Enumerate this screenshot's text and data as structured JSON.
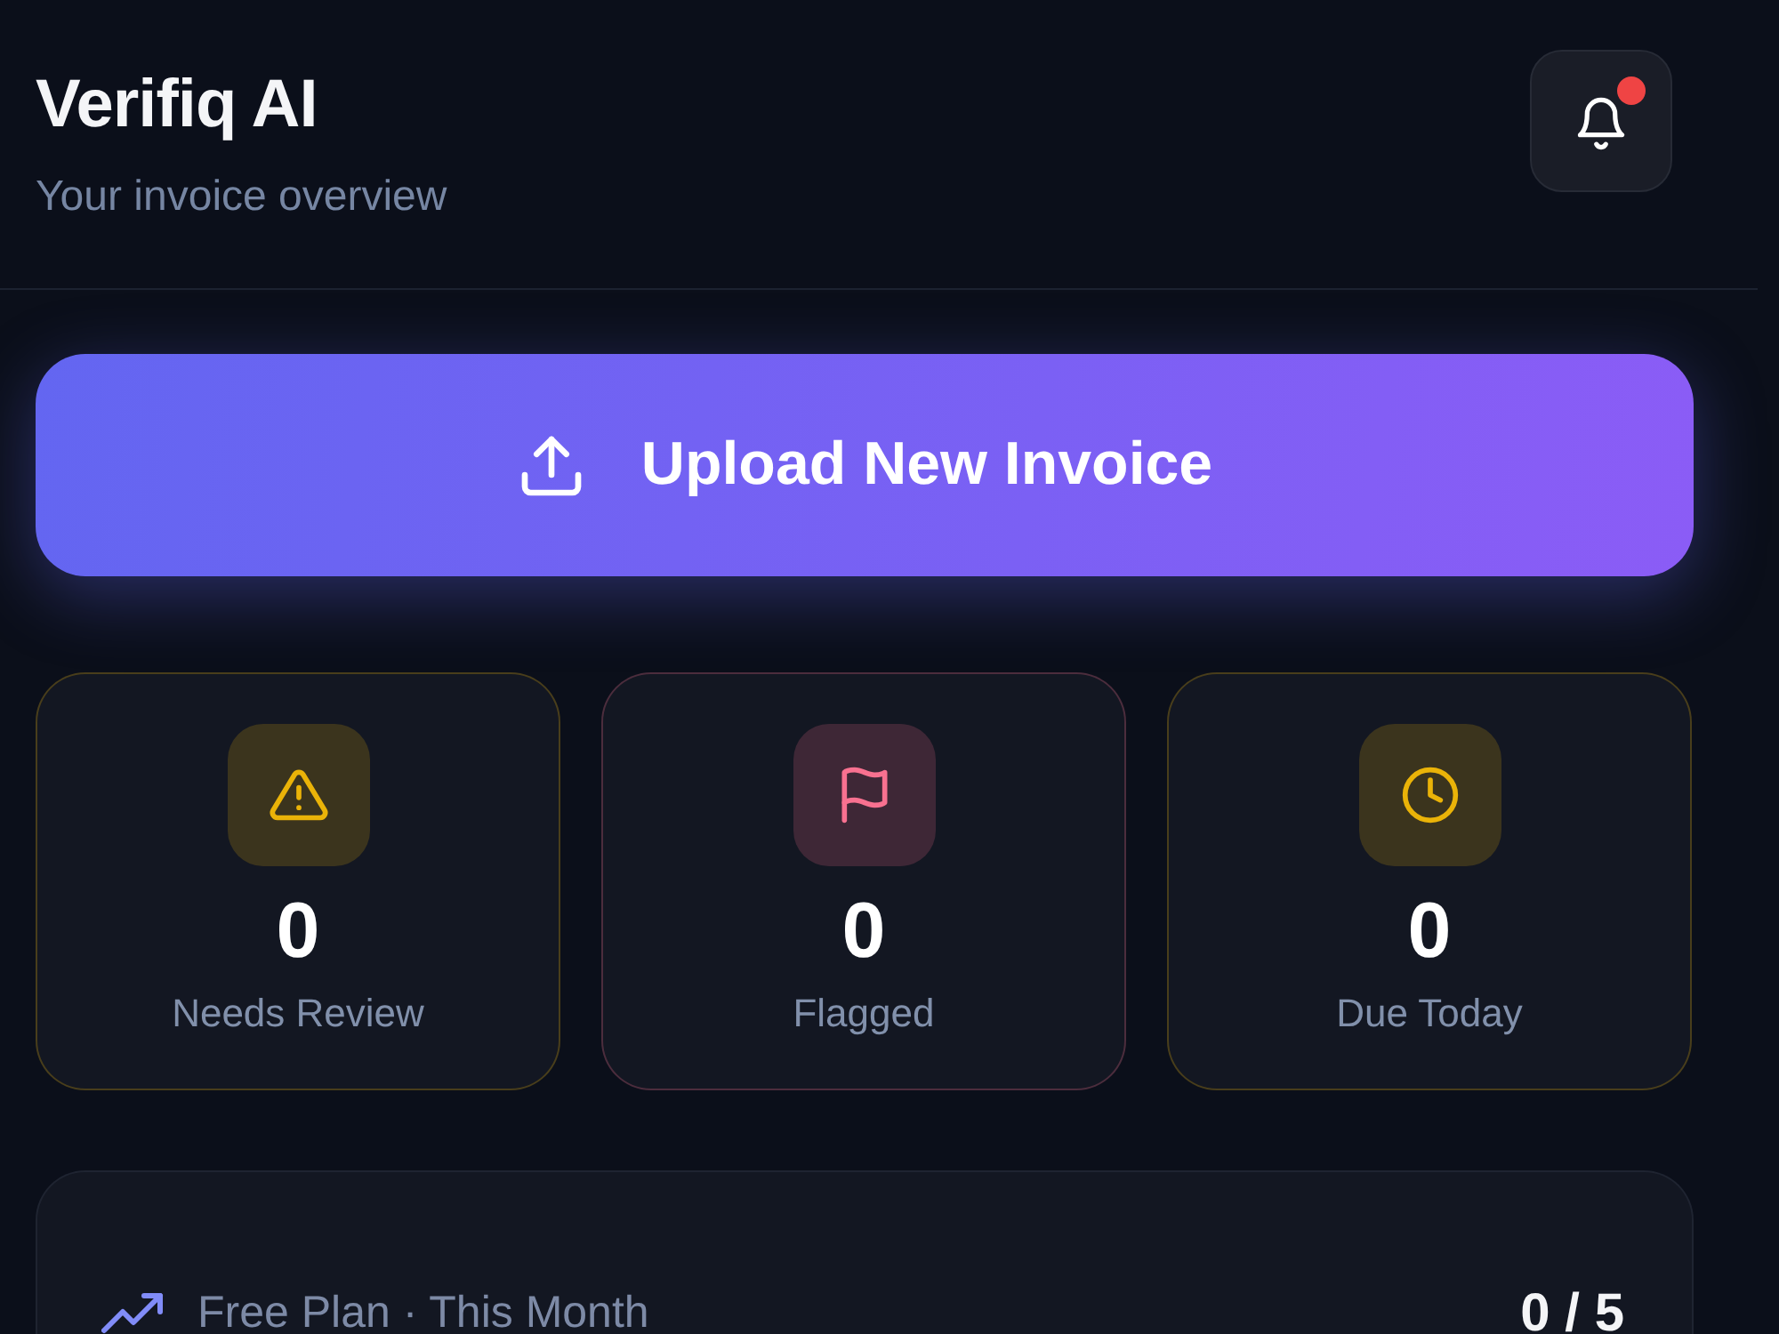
{
  "header": {
    "title": "Verifiq AI",
    "subtitle": "Your invoice overview",
    "notifications": {
      "unread": true
    }
  },
  "upload_button": {
    "label": "Upload New Invoice"
  },
  "stats": [
    {
      "kind": "warning",
      "color": "#eab308",
      "value": "0",
      "label": "Needs Review"
    },
    {
      "kind": "flag",
      "color": "#f87190",
      "value": "0",
      "label": "Flagged"
    },
    {
      "kind": "clock",
      "color": "#eab308",
      "value": "0",
      "label": "Due Today"
    }
  ],
  "plan": {
    "label": "Free Plan · This Month",
    "usage": "0 / 5"
  }
}
